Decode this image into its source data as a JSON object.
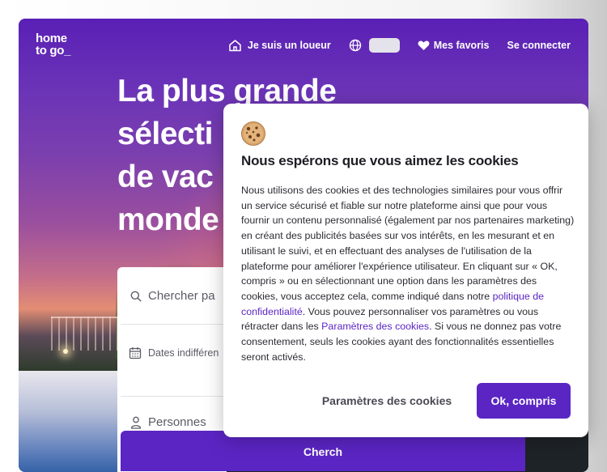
{
  "brand": {
    "logo_line1": "home",
    "logo_line2": "to go_"
  },
  "nav": {
    "host_label": "Je suis un loueur",
    "favorites_label": "Mes favoris",
    "login_label": "Se connecter"
  },
  "hero": {
    "title_lines": [
      "La plus grande",
      "sélecti",
      "de vac",
      "monde"
    ]
  },
  "search": {
    "destination_placeholder": "Chercher pa",
    "dates_placeholder": "Dates indifféren",
    "guests_placeholder": "Personnes",
    "button_label": "Cherch"
  },
  "cookie": {
    "title": "Nous espérons que vous aimez les cookies",
    "body_part1": "Nous utilisons des cookies et des technologies similaires pour vous offrir un service sécurisé et fiable sur notre plateforme ainsi que pour vous fournir un contenu personnalisé (également par nos partenaires marketing) en créant des publicités basées sur vos intérêts, en les mesurant et en utilisant le suivi, et en effectuant des analyses de l'utilisation de la plateforme pour améliorer l'expérience utilisateur. En cliquant sur « OK, compris » ou en sélectionnant une option dans les paramètres des cookies, vous acceptez cela, comme indiqué dans notre ",
    "privacy_link": "politique de confidentialité",
    "body_part2": ". Vous pouvez personnaliser vos paramètres ou vous rétracter dans les ",
    "settings_link": "Paramètres des cookies",
    "body_part3": ". Si vous ne donnez pas votre consentement, seuls les cookies ayant des fonctionnalités essentielles seront activés.",
    "settings_button": "Paramètres des cookies",
    "ok_button": "Ok, compris"
  },
  "colors": {
    "brand_purple": "#5b25c4",
    "link": "#5b25c4"
  }
}
